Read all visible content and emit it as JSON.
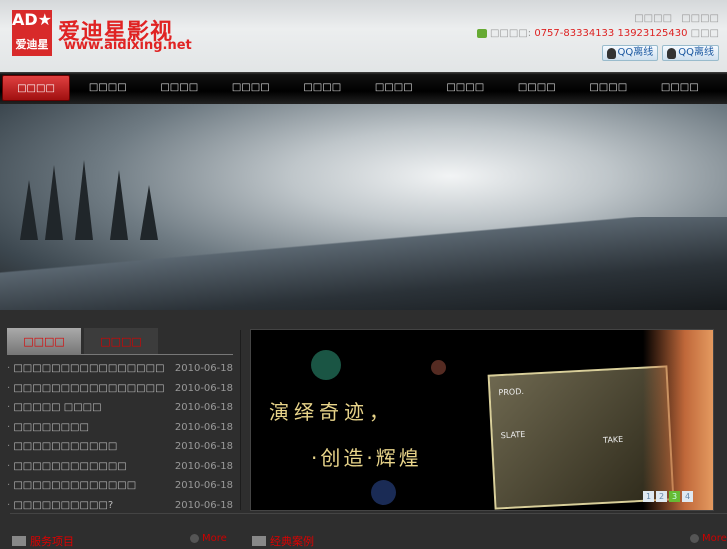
{
  "header": {
    "logo_mark": "AD★",
    "logo_mark_sub": "爱迪星",
    "logo_title": "爱迪星影视",
    "logo_url": "www.aidixing.net",
    "top_links": [
      "□□□□",
      "□□□□"
    ],
    "contact_label": "□□□□:",
    "phone": "0757-83334133  13923125430",
    "contact_suffix": "□□□",
    "qq_buttons": [
      "QQ离线",
      "QQ离线"
    ]
  },
  "nav": [
    "□□□□",
    "□□□□",
    "□□□□",
    "□□□□",
    "□□□□",
    "□□□□",
    "□□□□",
    "□□□□",
    "□□□□",
    "□□□□"
  ],
  "news": {
    "tabs": [
      "□□□□",
      "□□□□"
    ],
    "items": [
      {
        "title": "□□□□□□□□□□□□□□□□",
        "date": "2010-06-18"
      },
      {
        "title": "□□□□□□□□□□□□□□□□",
        "date": "2010-06-18"
      },
      {
        "title": "□□□□□ □□□□",
        "date": "2010-06-18"
      },
      {
        "title": "□□□□□□□□",
        "date": "2010-06-18"
      },
      {
        "title": "□□□□□□□□□□□",
        "date": "2010-06-18"
      },
      {
        "title": "□□□□□□□□□□□□",
        "date": "2010-06-18"
      },
      {
        "title": "□□□□□□□□□□□□□",
        "date": "2010-06-18"
      },
      {
        "title": "□□□□□□□□□□?",
        "date": "2010-06-18"
      }
    ]
  },
  "slide": {
    "line1": "演绎奇迹，",
    "line2": "·创造·辉煌",
    "clapper": [
      "PROD.",
      "SLATE",
      "TAKE"
    ],
    "pages": [
      "1",
      "2",
      "3",
      "4"
    ],
    "active_page": 3
  },
  "sections": [
    {
      "title": "服务项目",
      "more": "More"
    },
    {
      "title": "经典案例",
      "more": "More"
    }
  ]
}
